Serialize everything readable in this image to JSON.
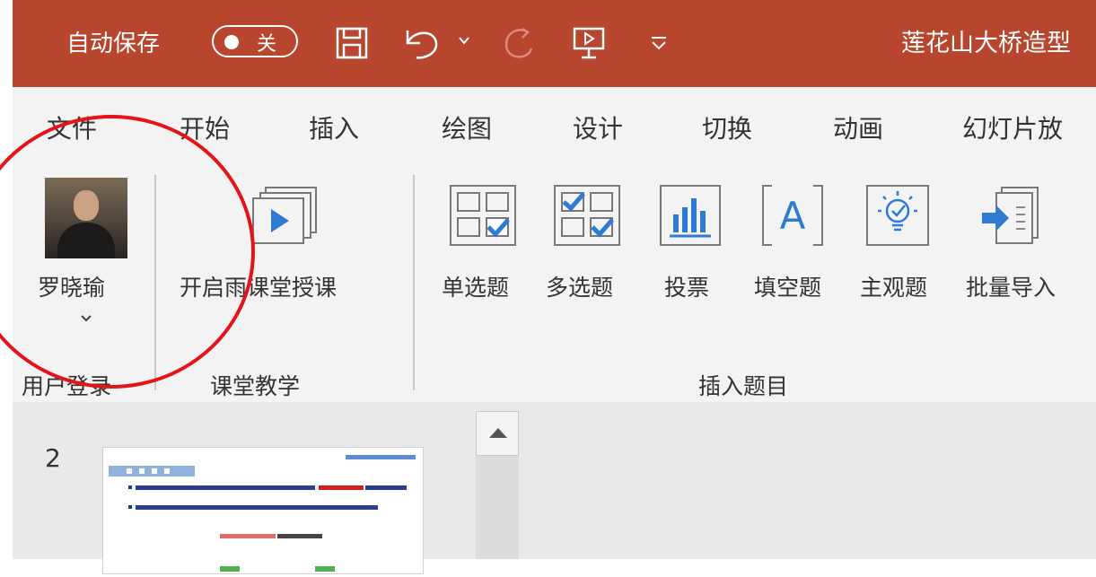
{
  "titlebar": {
    "autosave_label": "自动保存",
    "autosave_state": "关",
    "document_title": "莲花山大桥造型",
    "bg_color": "#b8452d"
  },
  "quick_access": [
    "save-icon",
    "undo-icon",
    "undo-dropdown-icon",
    "redo-icon",
    "present-icon",
    "customize-qat-icon"
  ],
  "tabs": [
    "文件",
    "开始",
    "插入",
    "绘图",
    "设计",
    "切换",
    "动画",
    "幻灯片放"
  ],
  "ribbon": {
    "user": {
      "name": "罗晓瑜",
      "group_label": "用户登录"
    },
    "classroom": {
      "button": "开启雨课堂授课",
      "group_label": "课堂教学"
    },
    "insert_question": {
      "group_label": "插入题目",
      "buttons": [
        "单选题",
        "多选题",
        "投票",
        "填空题",
        "主观题",
        "批量导入"
      ]
    }
  },
  "slide_panel": {
    "slide_number": "2"
  },
  "annotation": {
    "color": "#e4141b"
  }
}
